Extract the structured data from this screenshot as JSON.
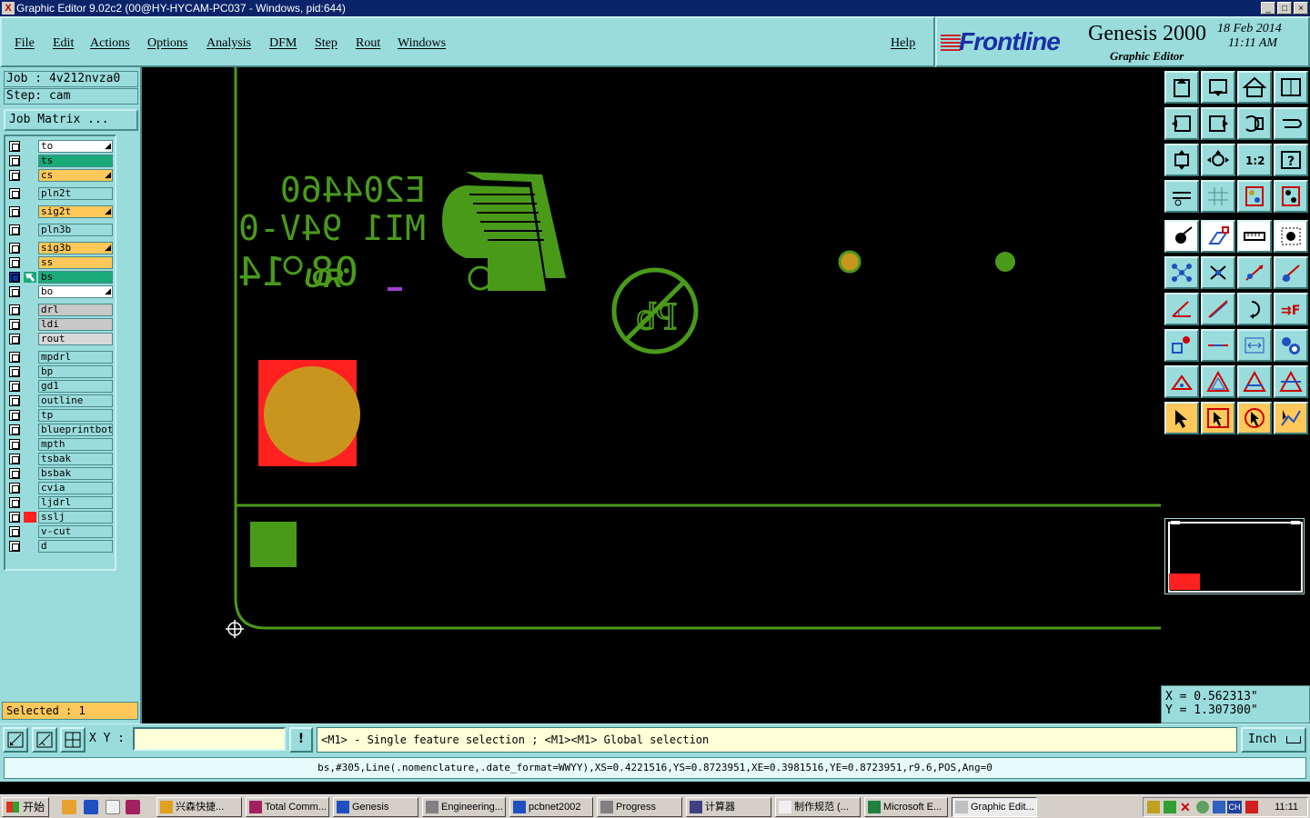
{
  "window": {
    "title": "Graphic Editor 9.02c2 (00@HY-HYCAM-PC037 - Windows, pid:644)",
    "btn_min": "_",
    "btn_max": "□",
    "btn_close": "×"
  },
  "menu": {
    "items": [
      "File",
      "Edit",
      "Actions",
      "Options",
      "Analysis",
      "DFM",
      "Step",
      "Rout",
      "Windows"
    ],
    "help": "Help"
  },
  "brand": {
    "logo": "Frontline",
    "product": "Genesis 2000",
    "subtitle": "Graphic Editor",
    "date": "18 Feb 2014",
    "time": "11:11 AM"
  },
  "job": {
    "job_line": "Job : 4v212nvza0",
    "step_line": "Step: cam",
    "matrix_button": "Job Matrix ..."
  },
  "layers": [
    {
      "name": "to",
      "color": "#ffffff",
      "arrow": true
    },
    {
      "name": "ts",
      "color": "#1aaa7a",
      "arrow": false
    },
    {
      "name": "cs",
      "color": "#ffc85a",
      "arrow": true
    },
    {
      "name": "pln2t",
      "color": "#9adcdc",
      "arrow": false,
      "gap": true
    },
    {
      "name": "sig2t",
      "color": "#ffc85a",
      "arrow": true,
      "gap": true
    },
    {
      "name": "pln3b",
      "color": "#9adcdc",
      "arrow": false,
      "gap": true
    },
    {
      "name": "sig3b",
      "color": "#ffc85a",
      "arrow": true,
      "gap": true
    },
    {
      "name": "ss",
      "color": "#ffc85a",
      "arrow": false
    },
    {
      "name": "bs",
      "color": "#1aaa7a",
      "arrow": false,
      "work": true
    },
    {
      "name": "bo",
      "color": "#ffffff",
      "arrow": true
    },
    {
      "name": "drl",
      "color": "#c8c8c8",
      "arrow": false,
      "gap": true
    },
    {
      "name": "ldi",
      "color": "#c8c8c8",
      "arrow": false
    },
    {
      "name": "rout",
      "color": "#d8d8d8",
      "arrow": false
    },
    {
      "name": "mpdrl",
      "color": "#9adcdc",
      "arrow": false,
      "gap": true
    },
    {
      "name": "bp",
      "color": "#9adcdc",
      "arrow": false
    },
    {
      "name": "gd1",
      "color": "#9adcdc",
      "arrow": false
    },
    {
      "name": "outline",
      "color": "#9adcdc",
      "arrow": false
    },
    {
      "name": "tp",
      "color": "#9adcdc",
      "arrow": false
    },
    {
      "name": "blueprintbot",
      "color": "#9adcdc",
      "arrow": false
    },
    {
      "name": "mpth",
      "color": "#9adcdc",
      "arrow": false
    },
    {
      "name": "tsbak",
      "color": "#9adcdc",
      "arrow": false
    },
    {
      "name": "bsbak",
      "color": "#9adcdc",
      "arrow": false
    },
    {
      "name": "cvia",
      "color": "#9adcdc",
      "arrow": false
    },
    {
      "name": "ljdrl",
      "color": "#9adcdc",
      "arrow": false
    },
    {
      "name": "sslj",
      "color": "#9adcdc",
      "arrow": false,
      "red": true
    },
    {
      "name": "v-cut",
      "color": "#9adcdc",
      "arrow": false
    },
    {
      "name": "d",
      "color": "#9adcdc",
      "arrow": false
    }
  ],
  "selected": "Selected : 1",
  "canvas": {
    "silk_line1": "E204460",
    "silk_line2": "MI1 94V-0",
    "silk_date": "08 14",
    "silk_ul": "UR",
    "silk_reg": "R",
    "pb_text": "Pb",
    "colors": {
      "silk": "#4a9a1a",
      "pad": "#c8961e",
      "pad_bg": "#ff2020",
      "outline": "#4a9a1a"
    }
  },
  "coords": {
    "x": "X  =  0.562313\"",
    "y": "Y  =  1.307300\""
  },
  "cmd": {
    "xy_label": "X Y :",
    "xy_value": "",
    "warn": "!",
    "prompt": "<M1> - Single feature selection ; <M1><M1> Global selection",
    "units": "Inch"
  },
  "info": "bs,#305,Line(.nomenclature,.date_format=WWYY),XS=0.4221516,YS=0.8723951,XE=0.3981516,YE=0.8723951,r9.6,POS,Ang=0",
  "taskbar": {
    "start": "开始",
    "tasks": [
      "兴森快捷...",
      "Total Comm...",
      "Genesis",
      "Engineering...",
      "pcbnet2002",
      "Progress",
      "计算器",
      "制作规范 (...",
      "Microsoft E...",
      "Graphic Edit..."
    ],
    "tray_ch": "CH",
    "clock": "11:11"
  },
  "toolbar_icons": [
    "home-icon",
    "open-step-icon",
    "home-view-icon",
    "window-split-icon",
    "pan-left-icon",
    "pan-right-icon",
    "undo-view-icon",
    "redraw-icon",
    "zoom-fit-icon",
    "zoom-center-icon",
    "zoom-1to1-icon",
    "query-icon",
    "settings-icon",
    "grid-icon",
    "layers-color-icon",
    "layers-multi-icon",
    "add-pad-icon",
    "add-shape-icon",
    "measure-ruler-icon",
    "add-dot-icon",
    "connect-nodes-icon",
    "cross-snap-icon",
    "line-point-icon",
    "line-pad-icon",
    "angle-icon",
    "slash-line-icon",
    "arc-icon",
    "text-edit-icon",
    "pad-resize-icon",
    "dash-line-icon",
    "measure-box-icon",
    "cluster-icon",
    "triangle-small-icon",
    "triangle-outline-icon",
    "triangle-base-icon",
    "triangle-cut-icon",
    "select-pointer-icon",
    "select-box-icon",
    "select-circle-icon",
    "select-route-icon"
  ]
}
